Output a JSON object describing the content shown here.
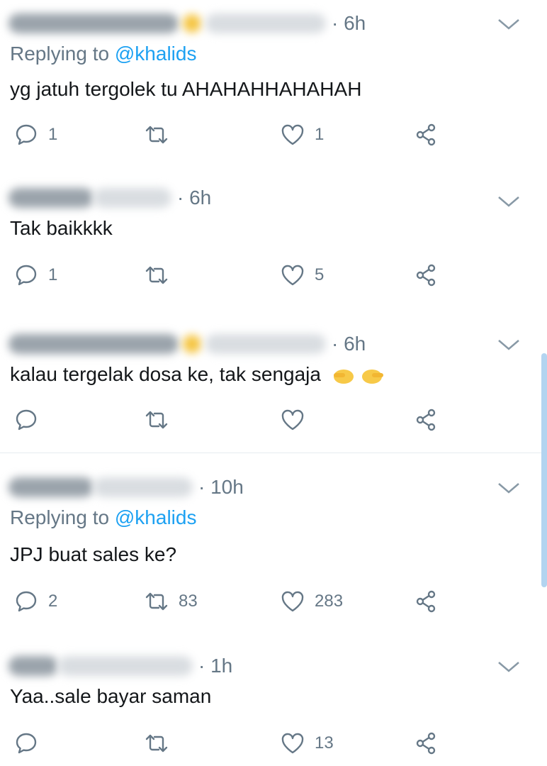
{
  "tweets": [
    {
      "time": "· 6h",
      "replying_label": "Replying to ",
      "replying_handle": "@khalids",
      "text": "yg jatuh tergolek tu AHAHAHHAHAHAH",
      "reply_count": "1",
      "retweet_count": "",
      "like_count": "1"
    },
    {
      "time": "· 6h",
      "text": "Tak baikkkk",
      "reply_count": "1",
      "retweet_count": "",
      "like_count": "5"
    },
    {
      "time": "· 6h",
      "text": "kalau tergelak dosa ke, tak sengaja",
      "reply_count": "",
      "retweet_count": "",
      "like_count": ""
    },
    {
      "time": "· 10h",
      "replying_label": "Replying to ",
      "replying_handle": "@khalids",
      "text": "JPJ buat sales ke?",
      "reply_count": "2",
      "retweet_count": "83",
      "like_count": "283"
    },
    {
      "time": "· 1h",
      "text": "Yaa..sale bayar saman",
      "reply_count": "",
      "retweet_count": "",
      "like_count": "13"
    }
  ],
  "icons": {
    "reply": "reply-bubble-icon",
    "retweet": "retweet-icon",
    "like": "heart-icon",
    "share": "share-icon",
    "menu": "chevron-down-icon"
  },
  "colors": {
    "accent": "#1da1f2",
    "muted": "#657786",
    "text": "#14171a"
  }
}
